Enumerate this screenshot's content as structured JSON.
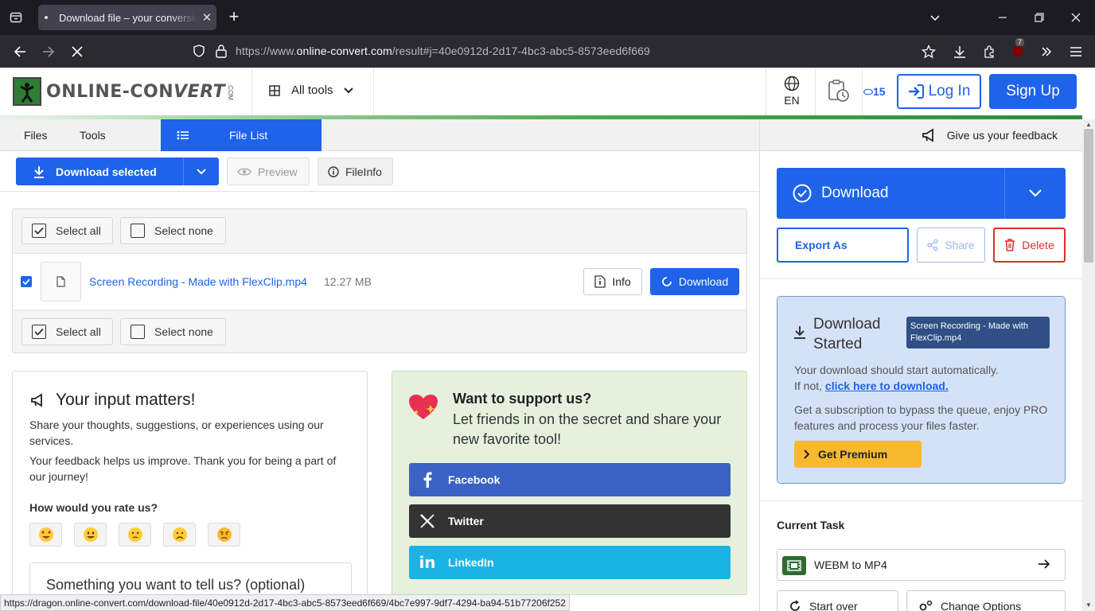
{
  "browser": {
    "tab_title": "Download file – your conversion",
    "url_prefix": "https://www.",
    "url_domain": "online-convert.com",
    "url_suffix": "/result#j=40e0912d-2d17-4bc3-abc5-8573eed6f669",
    "extension_badge": "7",
    "status_url": "https://dragon.online-convert.com/download-file/40e0912d-2d17-4bc3-abc5-8573eed6f669/4bc7e997-9df7-4294-ba94-51b77206f252"
  },
  "header": {
    "logo_text_a": "ONLINE-CON",
    "logo_text_b": "VERT",
    "logo_com": ".COM",
    "all_tools": "All tools",
    "language": "EN",
    "credits": "15",
    "login": "Log In",
    "signup": "Sign Up"
  },
  "subnav": {
    "files": "Files",
    "tools": "Tools",
    "file_list": "File List"
  },
  "toolbar": {
    "download_selected": "Download selected",
    "preview": "Preview",
    "fileinfo": "FileInfo"
  },
  "file_panel": {
    "select_all": "Select all",
    "select_none": "Select none",
    "file": {
      "name": "Screen Recording - Made with FlexClip.mp4",
      "size": "12.27 MB",
      "info": "Info",
      "download": "Download"
    }
  },
  "feedback_card": {
    "title": "Your input matters!",
    "p1": "Share your thoughts, suggestions, or experiences using our services.",
    "p2": "Your feedback helps us improve. Thank you for being a part of our journey!",
    "rate_label": "How would you rate us?",
    "emojis": [
      "😍",
      "😀",
      "🙁",
      "☹️",
      "😠"
    ],
    "textarea_placeholder": "Something you want to tell us? (optional)"
  },
  "support_card": {
    "title": "Want to support us?",
    "subtitle": "Let friends in on the secret and share your new favorite tool!",
    "facebook": "Facebook",
    "twitter": "Twitter",
    "linkedin": "LinkedIn",
    "colors": {
      "facebook": "#3b62c5",
      "twitter": "#333333",
      "linkedin": "#1ab3e6"
    }
  },
  "sidebar": {
    "feedback": "Give us your feedback",
    "download": "Download",
    "export_as": "Export As",
    "share": "Share",
    "delete": "Delete",
    "download_started": {
      "title": "Download Started",
      "file_badge": "Screen Recording - Made with FlexClip.mp4",
      "text1": "Your download should start automatically.",
      "text1b": "If not,",
      "link": "click here to download.",
      "text2": "Get a subscription to bypass the queue, enjoy PRO features and process your files faster.",
      "premium": "Get Premium"
    },
    "current_task_label": "Current Task",
    "task": "WEBM to MP4",
    "start_over": "Start over",
    "change_options": "Change Options"
  },
  "colors": {
    "primary": "#1e63e9",
    "danger": "#d9302c",
    "premium": "#f8b92e",
    "brand_green": "#2e7d32"
  }
}
